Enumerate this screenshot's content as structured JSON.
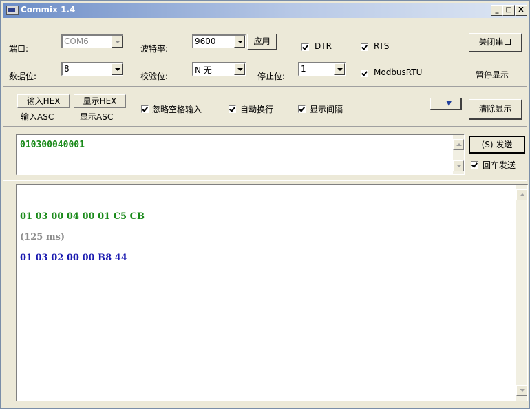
{
  "window": {
    "title": "Commix 1.4",
    "min": "_",
    "max": "□",
    "close": "X"
  },
  "serial": {
    "port_label": "端口:",
    "port_value": "COM6",
    "baud_label": "波特率:",
    "baud_value": "9600",
    "apply_label": "应用",
    "dtr_label": "DTR",
    "rts_label": "RTS",
    "close_port_label": "关闭串口",
    "databits_label": "数据位:",
    "databits_value": "8",
    "parity_label": "校验位:",
    "parity_value": "N 无",
    "stopbits_label": "停止位:",
    "stopbits_value": "1",
    "modbus_label": "ModbusRTU",
    "pause_label": "暂停显示"
  },
  "options": {
    "input_hex": "输入HEX",
    "input_asc": "输入ASC",
    "show_hex": "显示HEX",
    "show_asc": "显示ASC",
    "ignore_space": "忽略空格输入",
    "auto_wrap": "自动换行",
    "show_interval": "显示间隔",
    "more_label": "···▼",
    "clear_label": "清除显示"
  },
  "send": {
    "input_value": "010300040001",
    "send_label": "(S) 发送",
    "cr_label": "回车发送"
  },
  "output": {
    "lines": [
      {
        "text": "01 03 00 04 00 01 C5 CB",
        "color": "#1a8a1a"
      },
      {
        "text": "(125 ms)",
        "color": "#8c8c8c"
      },
      {
        "text": "01 03 02 00 00 B8 44",
        "color": "#1a1ab0"
      }
    ]
  }
}
